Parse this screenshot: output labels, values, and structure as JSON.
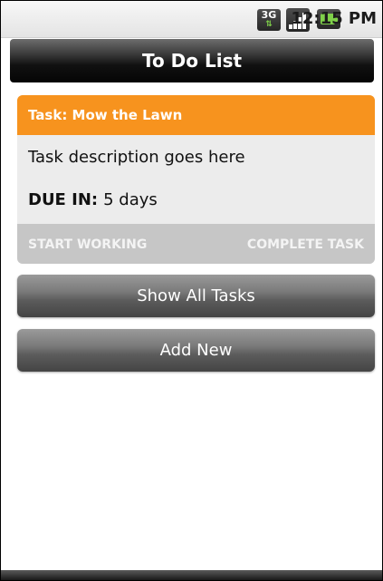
{
  "status_bar": {
    "network_icon": "3g-data-icon",
    "network_label": "3G",
    "data_arrows": "⇅",
    "signal_icon": "signal-strength-icon",
    "battery_icon": "battery-charging-icon",
    "time": "12:15 PM",
    "colors": {
      "battery": "#7fd04a"
    }
  },
  "header": {
    "title": "To Do List"
  },
  "task_card": {
    "title": "Task: Mow the Lawn",
    "description": "Task description goes here",
    "due_label": "DUE IN:",
    "due_value": "5 days",
    "start_label": "START WORKING",
    "complete_label": "COMPLETE TASK",
    "colors": {
      "header": "#f7931e",
      "body": "#ececec",
      "actions": "#c6c6c6"
    }
  },
  "buttons": {
    "show_all_label": "Show All Tasks",
    "add_new_label": "Add New"
  }
}
